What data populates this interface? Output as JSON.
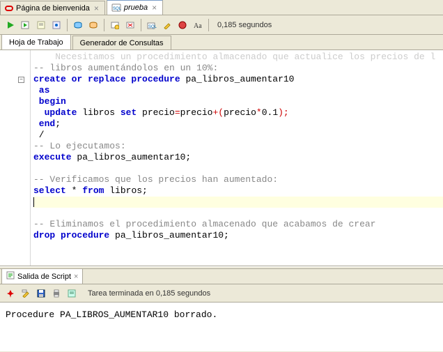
{
  "tabs": [
    {
      "label": "Página de bienvenida",
      "active": false,
      "italic": false
    },
    {
      "label": "prueba",
      "active": true,
      "italic": true
    }
  ],
  "toolbar_status": "0,185 segundos",
  "sub_tabs": {
    "worksheet": "Hoja de Trabajo",
    "querybuilder": "Generador de Consultas"
  },
  "code_lines": [
    {
      "t": "comment-dim",
      "text": "    Necesitamos un procedimiento almacenado que actualice los precios de l"
    },
    {
      "t": "comment",
      "text": "-- libros aumentándolos en un 10%:"
    },
    {
      "t": "create",
      "kw1": "create or replace procedure",
      "name": " pa_libros_aumentar10"
    },
    {
      "t": "kw",
      "text": " as"
    },
    {
      "t": "kw",
      "text": " begin"
    },
    {
      "t": "update",
      "pre": "  ",
      "kw1": "update",
      "mid1": " libros ",
      "kw2": "set",
      "mid2": " precio",
      "op1": "=",
      "mid3": "precio",
      "op2": "+(",
      "mid4": "precio",
      "op3": "*",
      "num": "0.1",
      "op4": ");"
    },
    {
      "t": "kwsemi",
      "kw": " end",
      "semi": ";"
    },
    {
      "t": "plain",
      "text": " /"
    },
    {
      "t": "comment",
      "text": "-- Lo ejecutamos:"
    },
    {
      "t": "exec",
      "kw": "execute",
      "rest": " pa_libros_aumentar10;"
    },
    {
      "t": "blank",
      "text": ""
    },
    {
      "t": "comment",
      "text": "-- Verificamos que los precios han aumentado:"
    },
    {
      "t": "select",
      "kw1": "select",
      "mid": " * ",
      "kw2": "from",
      "rest": " libros;"
    },
    {
      "t": "cursor",
      "text": ""
    },
    {
      "t": "blank",
      "text": ""
    },
    {
      "t": "comment",
      "text": "-- Eliminamos el procedimiento almacenado que acabamos de crear"
    },
    {
      "t": "drop",
      "kw": "drop procedure",
      "rest": " pa_libros_aumentar10;"
    }
  ],
  "output_tab_label": "Salida de Script",
  "output_status": "Tarea terminada en 0,185 segundos",
  "output_text": "Procedure PA_LIBROS_AUMENTAR10 borrado."
}
